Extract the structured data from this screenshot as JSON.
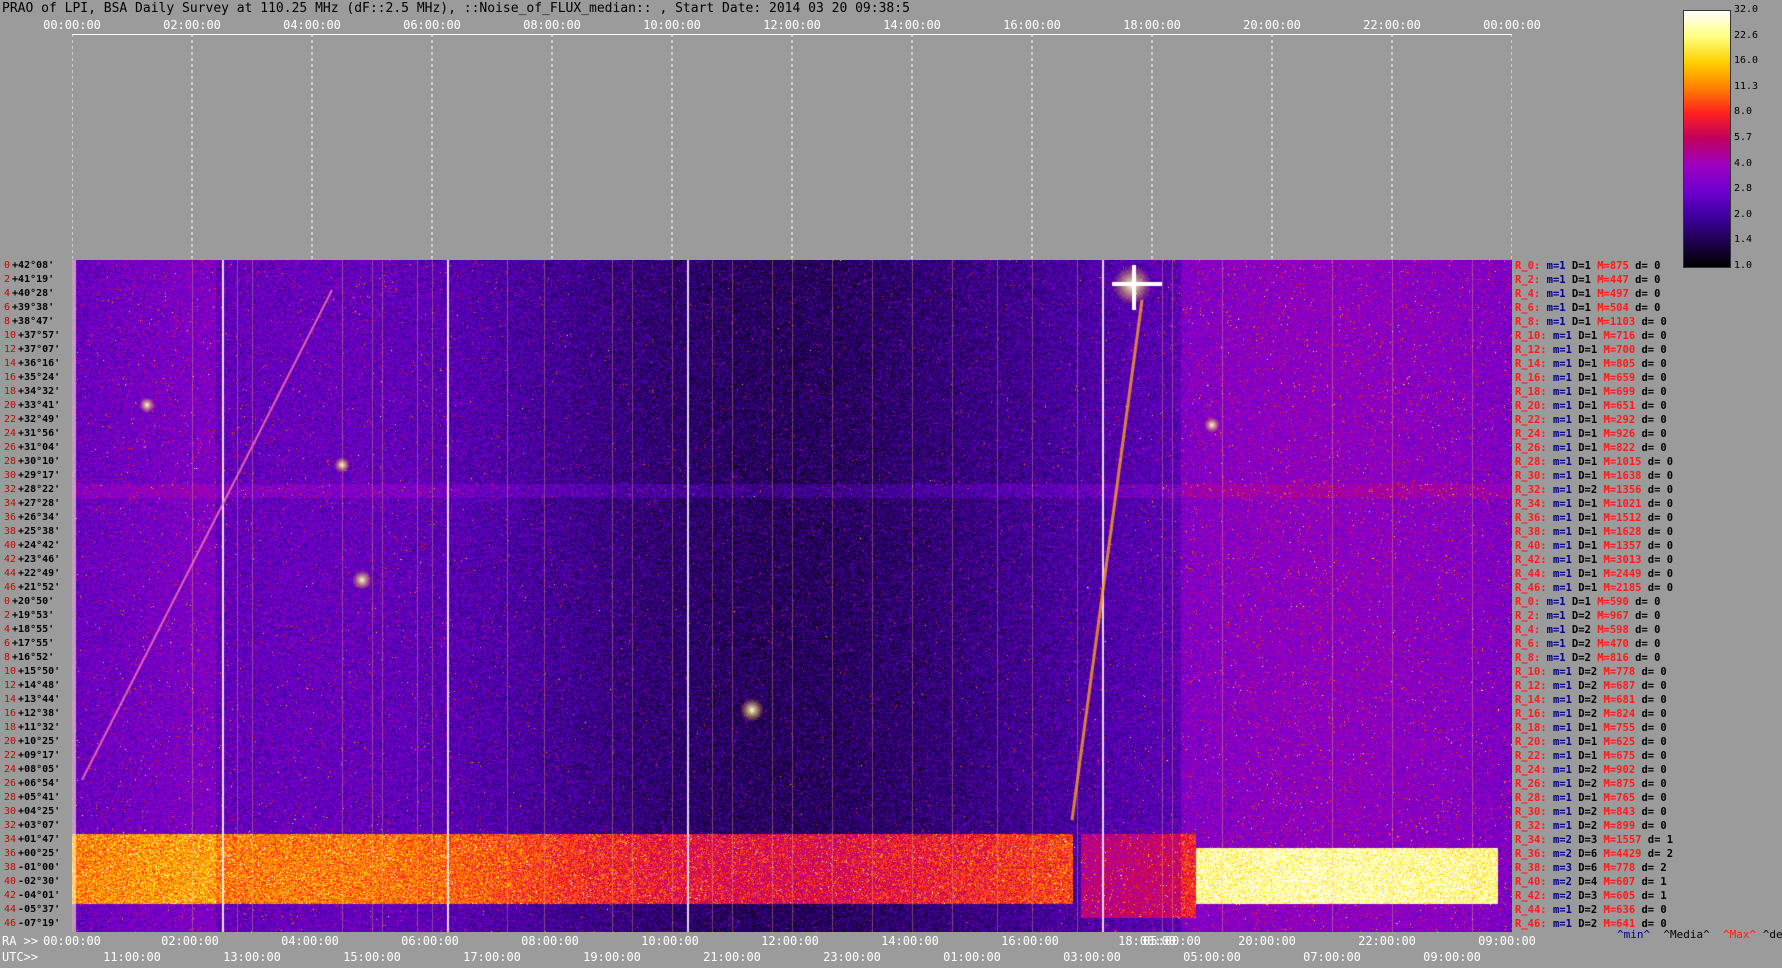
{
  "title": "PRAO of LPI, BSA Daily Survey at 110.25 MHz (dF::2.5 MHz), ::Noise_of_FLUX_median:: , Start Date: 2014 03 20 09:38:5",
  "top_axis": [
    "00:00:00",
    "02:00:00",
    "04:00:00",
    "06:00:00",
    "08:00:00",
    "10:00:00",
    "12:00:00",
    "14:00:00",
    "16:00:00",
    "18:00:00",
    "20:00:00",
    "22:00:00",
    "00:00:00"
  ],
  "dec_labels": [
    "+42°08'",
    "+41°19'",
    "+40°28'",
    "+39°38'",
    "+38°47'",
    "+37°57'",
    "+37°07'",
    "+36°16'",
    "+35°24'",
    "+34°32'",
    "+33°41'",
    "+32°49'",
    "+31°56'",
    "+31°04'",
    "+30°10'",
    "+29°17'",
    "+28°22'",
    "+27°28'",
    "+26°34'",
    "+25°38'",
    "+24°42'",
    "+23°46'",
    "+22°49'",
    "+21°52'",
    "+20°50'",
    "+19°53'",
    "+18°55'",
    "+17°55'",
    "+16°52'",
    "+15°50'",
    "+14°48'",
    "+13°44'",
    "+12°38'",
    "+11°32'",
    "+10°25'",
    "+09°17'",
    "+08°05'",
    "+06°54'",
    "+05°41'",
    "+04°25'",
    "+03°07'",
    "+01°47'",
    "+00°25'",
    "-01°00'",
    "-02°30'",
    "-04°01'",
    "-05°37'",
    "-07°19'"
  ],
  "dec_indices": [
    "0",
    "2",
    "4",
    "6",
    "8",
    "10",
    "12",
    "14",
    "16",
    "18",
    "20",
    "22",
    "24",
    "26",
    "28",
    "30",
    "32",
    "34",
    "36",
    "38",
    "40",
    "42",
    "44",
    "46",
    "0",
    "2",
    "4",
    "6",
    "8",
    "10",
    "12",
    "14",
    "16",
    "18",
    "20",
    "22",
    "24",
    "26",
    "28",
    "30",
    "32",
    "34",
    "36",
    "38",
    "40",
    "42",
    "44",
    "46"
  ],
  "row_stats": [
    {
      "r": "R_0:",
      "mn": "m=1",
      "d": "D=1",
      "mx": "M=875",
      "dv": "d= 0"
    },
    {
      "r": "R_2:",
      "mn": "m=1",
      "d": "D=1",
      "mx": "M=447",
      "dv": "d= 0"
    },
    {
      "r": "R_4:",
      "mn": "m=1",
      "d": "D=1",
      "mx": "M=497",
      "dv": "d= 0"
    },
    {
      "r": "R_6:",
      "mn": "m=1",
      "d": "D=1",
      "mx": "M=504",
      "dv": "d= 0"
    },
    {
      "r": "R_8:",
      "mn": "m=1",
      "d": "D=1",
      "mx": "M=1103",
      "dv": "d= 0"
    },
    {
      "r": "R_10:",
      "mn": "m=1",
      "d": "D=1",
      "mx": "M=716",
      "dv": "d= 0"
    },
    {
      "r": "R_12:",
      "mn": "m=1",
      "d": "D=1",
      "mx": "M=700",
      "dv": "d= 0"
    },
    {
      "r": "R_14:",
      "mn": "m=1",
      "d": "D=1",
      "mx": "M=805",
      "dv": "d= 0"
    },
    {
      "r": "R_16:",
      "mn": "m=1",
      "d": "D=1",
      "mx": "M=659",
      "dv": "d= 0"
    },
    {
      "r": "R_18:",
      "mn": "m=1",
      "d": "D=1",
      "mx": "M=699",
      "dv": "d= 0"
    },
    {
      "r": "R_20:",
      "mn": "m=1",
      "d": "D=1",
      "mx": "M=651",
      "dv": "d= 0"
    },
    {
      "r": "R_22:",
      "mn": "m=1",
      "d": "D=1",
      "mx": "M=292",
      "dv": "d= 0"
    },
    {
      "r": "R_24:",
      "mn": "m=1",
      "d": "D=1",
      "mx": "M=926",
      "dv": "d= 0"
    },
    {
      "r": "R_26:",
      "mn": "m=1",
      "d": "D=1",
      "mx": "M=822",
      "dv": "d= 0"
    },
    {
      "r": "R_28:",
      "mn": "m=1",
      "d": "D=1",
      "mx": "M=1015",
      "dv": "d= 0"
    },
    {
      "r": "R_30:",
      "mn": "m=1",
      "d": "D=1",
      "mx": "M=1638",
      "dv": "d= 0"
    },
    {
      "r": "R_32:",
      "mn": "m=1",
      "d": "D=2",
      "mx": "M=1356",
      "dv": "d= 0"
    },
    {
      "r": "R_34:",
      "mn": "m=1",
      "d": "D=1",
      "mx": "M=1021",
      "dv": "d= 0"
    },
    {
      "r": "R_36:",
      "mn": "m=1",
      "d": "D=1",
      "mx": "M=1512",
      "dv": "d= 0"
    },
    {
      "r": "R_38:",
      "mn": "m=1",
      "d": "D=1",
      "mx": "M=1628",
      "dv": "d= 0"
    },
    {
      "r": "R_40:",
      "mn": "m=1",
      "d": "D=1",
      "mx": "M=1357",
      "dv": "d= 0"
    },
    {
      "r": "R_42:",
      "mn": "m=1",
      "d": "D=1",
      "mx": "M=3013",
      "dv": "d= 0"
    },
    {
      "r": "R_44:",
      "mn": "m=1",
      "d": "D=1",
      "mx": "M=2449",
      "dv": "d= 0"
    },
    {
      "r": "R_46:",
      "mn": "m=1",
      "d": "D=1",
      "mx": "M=2185",
      "dv": "d= 0"
    },
    {
      "r": "R_0:",
      "mn": "m=1",
      "d": "D=1",
      "mx": "M=590",
      "dv": "d= 0"
    },
    {
      "r": "R_2:",
      "mn": "m=1",
      "d": "D=2",
      "mx": "M=967",
      "dv": "d= 0"
    },
    {
      "r": "R_4:",
      "mn": "m=1",
      "d": "D=2",
      "mx": "M=598",
      "dv": "d= 0"
    },
    {
      "r": "R_6:",
      "mn": "m=1",
      "d": "D=2",
      "mx": "M=470",
      "dv": "d= 0"
    },
    {
      "r": "R_8:",
      "mn": "m=1",
      "d": "D=2",
      "mx": "M=816",
      "dv": "d= 0"
    },
    {
      "r": "R_10:",
      "mn": "m=1",
      "d": "D=2",
      "mx": "M=778",
      "dv": "d= 0"
    },
    {
      "r": "R_12:",
      "mn": "m=1",
      "d": "D=2",
      "mx": "M=687",
      "dv": "d= 0"
    },
    {
      "r": "R_14:",
      "mn": "m=1",
      "d": "D=2",
      "mx": "M=681",
      "dv": "d= 0"
    },
    {
      "r": "R_16:",
      "mn": "m=1",
      "d": "D=2",
      "mx": "M=824",
      "dv": "d= 0"
    },
    {
      "r": "R_18:",
      "mn": "m=1",
      "d": "D=1",
      "mx": "M=755",
      "dv": "d= 0"
    },
    {
      "r": "R_20:",
      "mn": "m=1",
      "d": "D=1",
      "mx": "M=625",
      "dv": "d= 0"
    },
    {
      "r": "R_22:",
      "mn": "m=1",
      "d": "D=1",
      "mx": "M=675",
      "dv": "d= 0"
    },
    {
      "r": "R_24:",
      "mn": "m=1",
      "d": "D=2",
      "mx": "M=902",
      "dv": "d= 0"
    },
    {
      "r": "R_26:",
      "mn": "m=1",
      "d": "D=2",
      "mx": "M=875",
      "dv": "d= 0"
    },
    {
      "r": "R_28:",
      "mn": "m=1",
      "d": "D=1",
      "mx": "M=765",
      "dv": "d= 0"
    },
    {
      "r": "R_30:",
      "mn": "m=1",
      "d": "D=2",
      "mx": "M=843",
      "dv": "d= 0"
    },
    {
      "r": "R_32:",
      "mn": "m=1",
      "d": "D=2",
      "mx": "M=899",
      "dv": "d= 0"
    },
    {
      "r": "R_34:",
      "mn": "m=2",
      "d": "D=3",
      "mx": "M=1557",
      "dv": "d= 1"
    },
    {
      "r": "R_36:",
      "mn": "m=2",
      "d": "D=6",
      "mx": "M=4429",
      "dv": "d= 2"
    },
    {
      "r": "R_38:",
      "mn": "m=3",
      "d": "D=6",
      "mx": "M=778",
      "dv": "d= 2"
    },
    {
      "r": "R_40:",
      "mn": "m=2",
      "d": "D=4",
      "mx": "M=607",
      "dv": "d= 1"
    },
    {
      "r": "R_42:",
      "mn": "m=2",
      "d": "D=3",
      "mx": "M=605",
      "dv": "d= 1"
    },
    {
      "r": "R_44:",
      "mn": "m=1",
      "d": "D=2",
      "mx": "M=636",
      "dv": "d= 0"
    },
    {
      "r": "R_46:",
      "mn": "m=1",
      "d": "D=2",
      "mx": "M=641",
      "dv": "d= 0"
    }
  ],
  "colorbar": {
    "labels": [
      "32.0",
      "22.6",
      "16.0",
      "11.3",
      "8.0",
      "5.7",
      "4.0",
      "2.8",
      "2.0",
      "1.4",
      "1.0"
    ],
    "colors": [
      "#ffffff",
      "#ffff80",
      "#ffd000",
      "#ff8000",
      "#ff2020",
      "#c00060",
      "#a000c0",
      "#7000d0",
      "#4000a0",
      "#200050",
      "#000000"
    ]
  },
  "bottom_ra": {
    "prefix": "RA >>",
    "labels": [
      "00:00:00",
      "02:00:00",
      "04:00:00",
      "06:00:00",
      "08:00:00",
      "10:00:00",
      "12:00:00",
      "14:00:00",
      "16:00:00",
      "18:00:00",
      "05:00:00",
      "20:00:00",
      "22:00:00",
      "09:00:00"
    ]
  },
  "bottom_utc": {
    "prefix": "UTC>>",
    "labels": [
      "11:00:00",
      "13:00:00",
      "15:00:00",
      "17:00:00",
      "19:00:00",
      "21:00:00",
      "23:00:00",
      "01:00:00",
      "03:00:00",
      "05:00:00",
      "07:00:00",
      "09:00:00"
    ]
  },
  "legend": {
    "min": "^min^",
    "media": "^Media^",
    "max": "^Max^",
    "devia": "^devia^"
  },
  "chart_data": {
    "type": "heatmap",
    "title": "PRAO of LPI, BSA Daily Survey at 110.25 MHz (dF::2.5 MHz), ::Noise_of_FLUX_median:: , Start Date: 2014 03 20 09:38:5",
    "xlabel": "RA",
    "ylabel": "",
    "x_ticks_top": [
      "00:00:00",
      "02:00:00",
      "04:00:00",
      "06:00:00",
      "08:00:00",
      "10:00:00",
      "12:00:00",
      "14:00:00",
      "16:00:00",
      "18:00:00",
      "20:00:00",
      "22:00:00",
      "00:00:00"
    ],
    "y_ticks": [
      "+42°08'",
      "-07°19'"
    ],
    "colorscale": [
      "1.0",
      "1.4",
      "2.0",
      "2.8",
      "4.0",
      "5.7",
      "8.0",
      "11.3",
      "16.0",
      "22.6",
      "32.0"
    ],
    "rows": 48,
    "bright_band_rows": [
      41,
      42,
      43,
      44,
      45
    ],
    "grid": true
  }
}
